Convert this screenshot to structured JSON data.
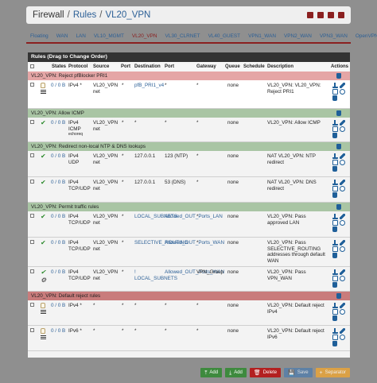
{
  "breadcrumb": {
    "part1": "Firewall",
    "sep": "/",
    "part2": "Rules",
    "part3": "VL20_VPN"
  },
  "tabs": [
    "Floating",
    "WAN",
    "LAN",
    "VL10_MGMT",
    "VL20_VPN",
    "VL30_CLRNET",
    "VL40_GUEST",
    "VPN1_WAN",
    "VPN2_WAN",
    "VPN3_WAN",
    "OpenVPN"
  ],
  "active_tab": "VL20_VPN",
  "panel_title": "Rules (Drag to Change Order)",
  "columns": {
    "states": "States",
    "protocol": "Protocol",
    "source": "Source",
    "port": "Port",
    "destination": "Destination",
    "dport": "Port",
    "gateway": "Gateway",
    "queue": "Queue",
    "schedule": "Schedule",
    "description": "Description",
    "actions": "Actions"
  },
  "colors": {
    "sep_red": "#e5a6a6",
    "sep_green": "#a9c5a4",
    "sep_darkred": "#c97c7c",
    "active_tab": "#8b2020",
    "link": "#2b5f96"
  },
  "sections": {
    "s1": {
      "label": "VL20_VPN: Reject pfBlocker PRI1"
    },
    "s2": {
      "label": "VL20_VPN: Allow ICMP"
    },
    "s3": {
      "label": "VL20_VPN: Redirect non-local NTP & DNS lookups"
    },
    "s4": {
      "label": "VL20_VPN: Permit traffic rules"
    },
    "s5": {
      "label": "VL20_VPN: Default reject rules"
    }
  },
  "rules": {
    "r1": {
      "states": "0 / 0 B",
      "protocol": "IPv4 *",
      "source": "VL20_VPN net",
      "port": "*",
      "dest": "pfB_PRI1_v4",
      "dport": "*",
      "gateway": "*",
      "queue": "none",
      "desc": "VL20_VPN: VL20_VPN: Reject PRI1"
    },
    "r2": {
      "states": "0 / 0 B",
      "protocol": "IPv4 ICMP",
      "protocol2": "echoreq",
      "source": "VL20_VPN net",
      "port": "*",
      "dest": "*",
      "dport": "*",
      "gateway": "*",
      "queue": "none",
      "desc": "VL20_VPN: Allow ICMP"
    },
    "r3": {
      "states": "0 / 0 B",
      "protocol": "IPv4 UDP",
      "source": "VL20_VPN net",
      "port": "*",
      "dest": "127.0.0.1",
      "dport": "123 (NTP)",
      "gateway": "*",
      "queue": "none",
      "desc": "NAT VL20_VPN: NTP redirect"
    },
    "r4": {
      "states": "0 / 0 B",
      "protocol": "IPv4 TCP/UDP",
      "source": "VL20_VPN net",
      "port": "*",
      "dest": "127.0.0.1",
      "dport": "53 (DNS)",
      "gateway": "*",
      "queue": "none",
      "desc": "NAT VL20_VPN: DNS redirect"
    },
    "r5": {
      "states": "0 / 0 B",
      "protocol": "IPv4 TCP/UDP",
      "source": "VL20_VPN net",
      "port": "*",
      "dest": "LOCAL_SUBNETS",
      "dport": "Allowed_OUT_Ports_LAN",
      "gateway": "*",
      "queue": "none",
      "desc": "VL20_VPN: Pass approved LAN"
    },
    "r6": {
      "states": "0 / 0 B",
      "protocol": "IPv4 TCP/UDP",
      "source": "VL20_VPN net",
      "port": "*",
      "dest": "SELECTIVE_ROUTING",
      "dport": "Allowed_OUT_Ports_WAN",
      "gateway": "*",
      "queue": "none",
      "desc": "VL20_VPN: Pass SELECTIVE_ROUTING addresses through default WAN"
    },
    "r7": {
      "states": "0 / 0 B",
      "protocol": "IPv4 TCP/UDP",
      "source": "VL20_VPN net",
      "port": "*",
      "dest": "! LOCAL_SUBNETS",
      "dport": "Allowed_OUT_Ports_WAN",
      "gateway": "VPN_Group",
      "queue": "none",
      "desc": "VL20_VPN: Pass VPN_WAN"
    },
    "r8": {
      "states": "0 / 0 B",
      "protocol": "IPv4 *",
      "source": "*",
      "port": "*",
      "dest": "*",
      "dport": "*",
      "gateway": "*",
      "queue": "none",
      "desc": "VL20_VPN: Default reject IPv4"
    },
    "r9": {
      "states": "0 / 0 B",
      "protocol": "IPv6 *",
      "source": "*",
      "port": "*",
      "dest": "*",
      "dport": "*",
      "gateway": "*",
      "queue": "none",
      "desc": "VL20_VPN: Default reject IPv6"
    }
  },
  "buttons": {
    "add_top": "Add",
    "add_bottom": "Add",
    "delete": "Delete",
    "save": "Save",
    "separator": "Separator"
  }
}
